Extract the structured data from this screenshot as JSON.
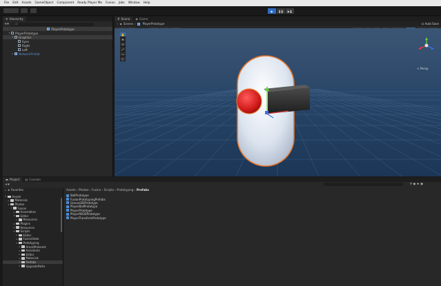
{
  "menu": [
    "File",
    "Edit",
    "Assets",
    "GameObject",
    "Component",
    "Ready Player Me",
    "Fusion",
    "Jobs",
    "Window",
    "Help"
  ],
  "hierarchy": {
    "tab": "Hierarchy",
    "search_placeholder": "All",
    "scene_root": "PlayerPrototype",
    "rows": [
      {
        "label": "PlayerPrototype",
        "indent": 1,
        "expanded": true,
        "state": "normal"
      },
      {
        "label": "Graphics",
        "indent": 2,
        "expanded": true,
        "state": "selected"
      },
      {
        "label": "Eyes",
        "indent": 3,
        "expanded": false,
        "state": "normal"
      },
      {
        "label": "Right",
        "indent": 3,
        "expanded": false,
        "state": "normal"
      },
      {
        "label": "Left",
        "indent": 3,
        "expanded": false,
        "state": "normal"
      },
      {
        "label": "NetworkPrefab",
        "indent": 2,
        "expanded": false,
        "state": "prefab"
      }
    ]
  },
  "scene": {
    "tabs": [
      "Scene",
      "Game"
    ],
    "breadcrumb_scenes": "Scenes",
    "breadcrumb_prefab": "PlayerPrototype",
    "auto_save": "Auto Save",
    "persp_label": "< Persp"
  },
  "project": {
    "tabs": [
      "Project",
      "Console"
    ],
    "favorites": "Favorites",
    "tree": [
      {
        "label": "Assets",
        "indent": 0,
        "expanded": true
      },
      {
        "label": "Materials",
        "indent": 1,
        "expanded": false
      },
      {
        "label": "Photon",
        "indent": 1,
        "expanded": true
      },
      {
        "label": "Fusion",
        "indent": 2,
        "expanded": true
      },
      {
        "label": "Assemblies",
        "indent": 3,
        "expanded": false
      },
      {
        "label": "Editor",
        "indent": 3,
        "expanded": true
      },
      {
        "label": "Resources",
        "indent": 4,
        "expanded": false
      },
      {
        "label": "Plugins",
        "indent": 3,
        "expanded": false
      },
      {
        "label": "Resources",
        "indent": 3,
        "expanded": false
      },
      {
        "label": "Scripts",
        "indent": 3,
        "expanded": true
      },
      {
        "label": "Editor",
        "indent": 4,
        "expanded": false
      },
      {
        "label": "FusionStats",
        "indent": 4,
        "expanded": false
      },
      {
        "label": "Prototyping",
        "indent": 4,
        "expanded": true
      },
      {
        "label": "AreaOfInterest",
        "indent": 5,
        "expanded": false
      },
      {
        "label": "Assistants",
        "indent": 5,
        "expanded": false
      },
      {
        "label": "Editor",
        "indent": 5,
        "expanded": false
      },
      {
        "label": "Materials",
        "indent": 5,
        "expanded": false
      },
      {
        "label": "Prefabs",
        "indent": 5,
        "expanded": false,
        "selected": true
      },
      {
        "label": "UpgradePaths",
        "indent": 5,
        "expanded": false
      }
    ],
    "breadcrumb": [
      "Assets",
      "Photon",
      "Fusion",
      "Scripts",
      "Prototyping"
    ],
    "breadcrumb_current": "Prefabs",
    "files": [
      "BallPrototype",
      "FusionPrototypingPrefabs",
      "Ground3DPrototype",
      "PlayerBallPrototype",
      "PlayerPrototype",
      "PlayerRB3DPrototype",
      "PlayerTransformPrototype"
    ]
  },
  "colors": {
    "accent": "#2c5d87",
    "play_active": "#2d6bbf",
    "sky": "#2f4b6b",
    "ground": "#1f3a58",
    "selection_outline": "#e8752a",
    "capsule": "#dfe6f0",
    "red_eye": "#d11b1b"
  }
}
